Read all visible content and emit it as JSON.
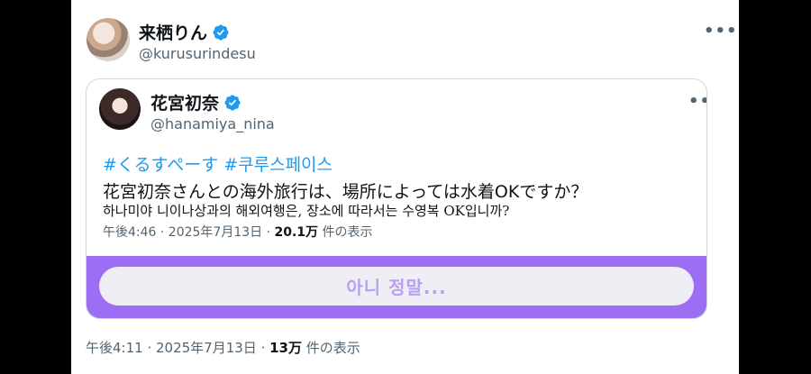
{
  "outer_tweet": {
    "display_name": "来栖りん",
    "handle": "@kurusurindesu",
    "more_label": "•••",
    "meta_time": "午後4:11 · 2025年7月13日 · ",
    "meta_views": "13万",
    "meta_views_suffix": " 件の表示"
  },
  "quoted_tweet": {
    "display_name": "花宮初奈",
    "handle": "@hanamiya_nina",
    "more_label": "•••",
    "hashtags": [
      "#くるすぺーす",
      "#쿠루스페이스"
    ],
    "text_jp": "花宮初奈さんとの海外旅行は、場所によっては水着OKですか？",
    "text_ko": "하나미야 니이나상과의 해외여행은, 장소에 따라서는 수영복 OK입니까?",
    "meta_time": "午後4:46 · 2025年7月13日 · ",
    "meta_views": "20.1万",
    "meta_views_suffix": " 件の表示"
  },
  "subtitle": {
    "text": "아니 정말..."
  },
  "colors": {
    "accent": "#1d9bf0",
    "subtitle_band": "#9b6ef3",
    "subtitle_text": "#b9a0f0",
    "secondary_text": "#536471"
  }
}
